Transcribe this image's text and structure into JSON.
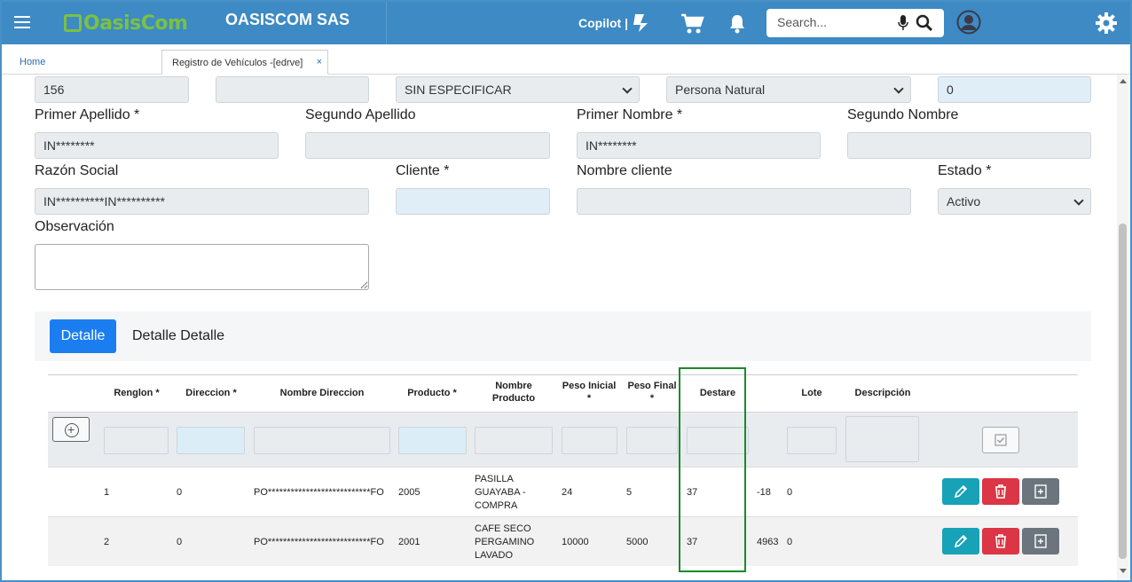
{
  "header": {
    "logo_text": "OasisCom",
    "company": "OASISCOM SAS",
    "copilot": "Copilot |",
    "search_placeholder": "Search..."
  },
  "tabs": {
    "home": "Home",
    "active": "Registro de Vehículos -[edrve]",
    "close": "×"
  },
  "form": {
    "row0": {
      "field1": "156",
      "field2": "",
      "field3": "SIN ESPECIFICAR",
      "field4": "Persona Natural",
      "field5": "0"
    },
    "labels": {
      "primer_apellido": "Primer Apellido *",
      "segundo_apellido": "Segundo Apellido",
      "primer_nombre": "Primer Nombre *",
      "segundo_nombre": "Segundo Nombre",
      "razon_social": "Razón Social",
      "cliente": "Cliente *",
      "nombre_cliente": "Nombre cliente",
      "estado": "Estado *",
      "observacion": "Observación"
    },
    "values": {
      "primer_apellido": "IN********",
      "segundo_apellido": "",
      "primer_nombre": "IN********",
      "segundo_nombre": "",
      "razon_social": "IN**********IN**********",
      "cliente": "",
      "nombre_cliente": "",
      "estado": "Activo"
    }
  },
  "detail_tabs": [
    "Detalle",
    "Detalle Detalle"
  ],
  "grid": {
    "headers": {
      "renglon": "Renglon *",
      "direccion": "Direccion *",
      "nombre_direccion": "Nombre Direccion",
      "producto": "Producto *",
      "nombre_producto_1": "Nombre",
      "nombre_producto_2": "Producto",
      "peso_inicial_1": "Peso Inicial",
      "peso_inicial_2": "*",
      "peso_final_1": "Peso Final",
      "peso_final_2": "*",
      "destare": "Destare",
      "lote": "Lote",
      "descripcion": "Descripción"
    },
    "rows": [
      {
        "renglon": "1",
        "direccion": "0",
        "nombre_direccion": "PO***************************FO",
        "producto": "2005",
        "nombre_producto": [
          "PASILLA",
          "GUAYABA -",
          "COMPRA"
        ],
        "peso_inicial": "24",
        "peso_final": "5",
        "destare": "37",
        "neto": "-18",
        "lote": "0"
      },
      {
        "renglon": "2",
        "direccion": "0",
        "nombre_direccion": "PO***************************FO",
        "producto": "2001",
        "nombre_producto": [
          "CAFE SECO",
          "PERGAMINO",
          "LAVADO"
        ],
        "peso_inicial": "10000",
        "peso_final": "5000",
        "destare": "37",
        "neto": "4963",
        "lote": "0"
      }
    ]
  },
  "colors": {
    "topbar": "#3d8ac4",
    "logo_green": "#7bc142",
    "primary": "#1a7ef0",
    "edit": "#17a2b8",
    "delete": "#dc3545",
    "duplicate": "#6c757d",
    "highlight": "#1a8a2a"
  }
}
